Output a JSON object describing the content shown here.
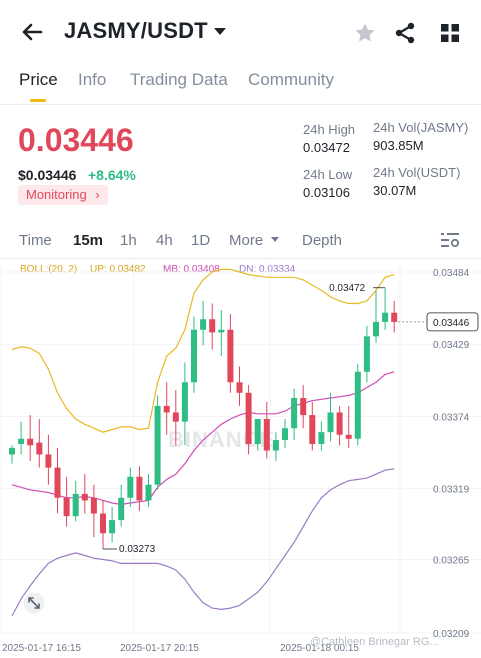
{
  "header": {
    "pair": "JASMY/USDT",
    "back_icon": "arrow-left-icon",
    "star_icon": "star-icon",
    "share_icon": "share-icon",
    "menu_icon": "grid-icon"
  },
  "tabs": [
    {
      "label": "Price",
      "active": true
    },
    {
      "label": "Info",
      "active": false
    },
    {
      "label": "Trading Data",
      "active": false
    },
    {
      "label": "Community",
      "active": false
    }
  ],
  "ticker": {
    "price": "0.03446",
    "price_usd": "$0.03446",
    "change": "+8.64%",
    "monitoring": "Monitoring",
    "high_label": "24h High",
    "high_value": "0.03472",
    "low_label": "24h Low",
    "low_value": "0.03106",
    "vol_jasmy_label": "24h Vol(JASMY)",
    "vol_jasmy_value": "903.85M",
    "vol_usdt_label": "24h Vol(USDT)",
    "vol_usdt_value": "30.07M"
  },
  "timeframes": {
    "items": [
      "Time",
      "15m",
      "1h",
      "4h",
      "1D",
      "More",
      "Depth"
    ],
    "active": "15m"
  },
  "legend": {
    "boll": "BOLL:(20, 2)",
    "up": "UP: 0.03482",
    "mb": "MB: 0.03408",
    "dn": "DN: 0.03334"
  },
  "colors": {
    "up": "#2ebd85",
    "down": "#e0475b",
    "upper_band": "#e8b923",
    "mid_band": "#cf4fb5",
    "lower_band": "#9b7bc6",
    "accent": "#f0b90b"
  },
  "watermark": "BINANCE",
  "credit": "@Cathleen Brinegar RG...",
  "chart_data": {
    "type": "candlestick",
    "y_ticks": [
      "0.03484",
      "0.03429",
      "0.03374",
      "0.03319",
      "0.03265",
      "0.03209"
    ],
    "ylim": [
      0.03209,
      0.03484
    ],
    "x_ticks": [
      "2025-01-17 16:15",
      "2025-01-17 20:15",
      "2025-01-18 00:15"
    ],
    "current_price": "0.03446",
    "high_marker": "0.03472",
    "low_marker": "0.03273",
    "candles": [
      {
        "o": 0.03345,
        "h": 0.03352,
        "c": 0.0335,
        "l": 0.03338
      },
      {
        "o": 0.03353,
        "h": 0.0337,
        "c": 0.03357,
        "l": 0.03345
      },
      {
        "o": 0.03357,
        "h": 0.03375,
        "c": 0.03352,
        "l": 0.0334
      },
      {
        "o": 0.03354,
        "h": 0.03372,
        "c": 0.03345,
        "l": 0.03335
      },
      {
        "o": 0.03345,
        "h": 0.0336,
        "c": 0.03335,
        "l": 0.03322
      },
      {
        "o": 0.03335,
        "h": 0.0335,
        "c": 0.03312,
        "l": 0.033
      },
      {
        "o": 0.03312,
        "h": 0.03328,
        "c": 0.03298,
        "l": 0.0329
      },
      {
        "o": 0.03298,
        "h": 0.03325,
        "c": 0.03315,
        "l": 0.03294
      },
      {
        "o": 0.03315,
        "h": 0.0333,
        "c": 0.0331,
        "l": 0.033
      },
      {
        "o": 0.03312,
        "h": 0.03322,
        "c": 0.033,
        "l": 0.03282
      },
      {
        "o": 0.033,
        "h": 0.0331,
        "c": 0.03285,
        "l": 0.03273
      },
      {
        "o": 0.03285,
        "h": 0.03305,
        "c": 0.03295,
        "l": 0.03278
      },
      {
        "o": 0.03295,
        "h": 0.03322,
        "c": 0.03312,
        "l": 0.0329
      },
      {
        "o": 0.03312,
        "h": 0.03335,
        "c": 0.03328,
        "l": 0.03305
      },
      {
        "o": 0.03328,
        "h": 0.03336,
        "c": 0.0331,
        "l": 0.03302
      },
      {
        "o": 0.0331,
        "h": 0.0333,
        "c": 0.03322,
        "l": 0.03305
      },
      {
        "o": 0.03322,
        "h": 0.0339,
        "c": 0.03382,
        "l": 0.03318
      },
      {
        "o": 0.03382,
        "h": 0.034,
        "c": 0.03377,
        "l": 0.0336
      },
      {
        "o": 0.03377,
        "h": 0.03394,
        "c": 0.0337,
        "l": 0.03352
      },
      {
        "o": 0.0337,
        "h": 0.03415,
        "c": 0.034,
        "l": 0.03352
      },
      {
        "o": 0.034,
        "h": 0.0345,
        "c": 0.0344,
        "l": 0.03392
      },
      {
        "o": 0.0344,
        "h": 0.03462,
        "c": 0.03448,
        "l": 0.03428
      },
      {
        "o": 0.03448,
        "h": 0.0346,
        "c": 0.03438,
        "l": 0.03425
      },
      {
        "o": 0.03438,
        "h": 0.03455,
        "c": 0.0344,
        "l": 0.0342
      },
      {
        "o": 0.0344,
        "h": 0.03452,
        "c": 0.034,
        "l": 0.03392
      },
      {
        "o": 0.034,
        "h": 0.03412,
        "c": 0.03392,
        "l": 0.03382
      },
      {
        "o": 0.03392,
        "h": 0.03398,
        "c": 0.03353,
        "l": 0.03345
      },
      {
        "o": 0.03353,
        "h": 0.03365,
        "c": 0.03372,
        "l": 0.03348
      },
      {
        "o": 0.03372,
        "h": 0.03385,
        "c": 0.03348,
        "l": 0.03342
      },
      {
        "o": 0.03348,
        "h": 0.03362,
        "c": 0.03356,
        "l": 0.0334
      },
      {
        "o": 0.03356,
        "h": 0.03372,
        "c": 0.03365,
        "l": 0.0335
      },
      {
        "o": 0.03365,
        "h": 0.03395,
        "c": 0.03388,
        "l": 0.03356
      },
      {
        "o": 0.03388,
        "h": 0.03398,
        "c": 0.03375,
        "l": 0.03365
      },
      {
        "o": 0.03375,
        "h": 0.03385,
        "c": 0.03353,
        "l": 0.03348
      },
      {
        "o": 0.03353,
        "h": 0.0337,
        "c": 0.03362,
        "l": 0.03348
      },
      {
        "o": 0.03362,
        "h": 0.03392,
        "c": 0.03377,
        "l": 0.03355
      },
      {
        "o": 0.03377,
        "h": 0.03382,
        "c": 0.0336,
        "l": 0.03352
      },
      {
        "o": 0.0336,
        "h": 0.03382,
        "c": 0.03357,
        "l": 0.0335
      },
      {
        "o": 0.03357,
        "h": 0.03414,
        "c": 0.03408,
        "l": 0.03352
      },
      {
        "o": 0.03408,
        "h": 0.03443,
        "c": 0.03435,
        "l": 0.034
      },
      {
        "o": 0.03435,
        "h": 0.0347,
        "c": 0.03446,
        "l": 0.0343
      },
      {
        "o": 0.03446,
        "h": 0.03472,
        "c": 0.03453,
        "l": 0.0344
      },
      {
        "o": 0.03453,
        "h": 0.03462,
        "c": 0.03446,
        "l": 0.03438
      }
    ],
    "upper_band": [
      0.03425,
      0.03427,
      0.03426,
      0.03422,
      0.0341,
      0.03392,
      0.0338,
      0.03372,
      0.03368,
      0.03365,
      0.03362,
      0.03364,
      0.03366,
      0.03366,
      0.03364,
      0.03365,
      0.034,
      0.0342,
      0.03426,
      0.0344,
      0.03468,
      0.03478,
      0.03484,
      0.03486,
      0.03486,
      0.03484,
      0.03482,
      0.03481,
      0.0348,
      0.0348,
      0.0348,
      0.0348,
      0.03478,
      0.03474,
      0.0347,
      0.03465,
      0.03462,
      0.0346,
      0.0346,
      0.03462,
      0.0347,
      0.0348,
      0.03482
    ],
    "mid_band": [
      0.03322,
      0.0332,
      0.03318,
      0.03317,
      0.03316,
      0.03314,
      0.03312,
      0.03312,
      0.03313,
      0.03312,
      0.0331,
      0.03308,
      0.03307,
      0.03308,
      0.03309,
      0.0331,
      0.0332,
      0.03326,
      0.0333,
      0.03338,
      0.03348,
      0.03356,
      0.03362,
      0.03368,
      0.03372,
      0.03375,
      0.03377,
      0.03376,
      0.03376,
      0.03376,
      0.03378,
      0.03382,
      0.03384,
      0.03386,
      0.03387,
      0.03388,
      0.03389,
      0.0339,
      0.03392,
      0.03396,
      0.034,
      0.03406,
      0.03408
    ],
    "lower_band": [
      0.03222,
      0.03235,
      0.03245,
      0.03254,
      0.03262,
      0.03266,
      0.03268,
      0.0327,
      0.03268,
      0.03266,
      0.03265,
      0.03264,
      0.03262,
      0.03262,
      0.03262,
      0.03262,
      0.03262,
      0.0326,
      0.03257,
      0.0325,
      0.0324,
      0.03232,
      0.03228,
      0.03227,
      0.03228,
      0.0323,
      0.03235,
      0.0324,
      0.03248,
      0.03258,
      0.03268,
      0.03278,
      0.0329,
      0.03302,
      0.03312,
      0.03318,
      0.03322,
      0.03325,
      0.03326,
      0.03327,
      0.0333,
      0.03333,
      0.03334
    ]
  }
}
